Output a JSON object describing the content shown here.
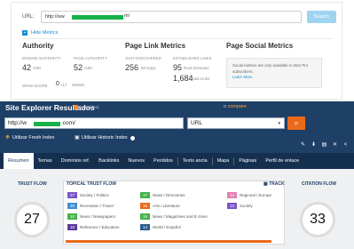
{
  "moz": {
    "url_label": "URL:",
    "url_prefix": "http://ww",
    "url_suffix": "m/",
    "search_label": "Search",
    "hide_metrics": "Hide Metrics",
    "authority": {
      "title": "Authority",
      "domain_authority_label": "DOMAIN AUTHORITY",
      "domain_authority_value": "42",
      "domain_authority_unit": "/100",
      "page_authority_label": "PAGE AUTHORITY",
      "page_authority_value": "52",
      "page_authority_unit": "/100",
      "spam_score_label": "SPAM SCORE",
      "spam_score_value": "0",
      "spam_score_unit": "/17"
    },
    "page_link_metrics": {
      "title": "Page Link Metrics",
      "just_discovered_label": "JUST-DISCOVERED",
      "just_discovered_value": "256",
      "just_discovered_unit": "60 Days",
      "established_links_label": "ESTABLISHED LINKS",
      "root_domains_value": "95",
      "root_domains_unit": "Root Domains",
      "total_links_value": "1,684",
      "total_links_unit": "Total Links"
    },
    "page_social_metrics": {
      "title": "Page Social Metrics",
      "message": "Social metrics are only available to Moz Pro subscribers.",
      "learn_more": "Learn More"
    }
  },
  "majestic": {
    "title": "Site Explorer Resultados",
    "video_label": "(ver vídeo)",
    "compare_prefix": "o",
    "compare_label": "compare",
    "url_prefix": "http://w",
    "url_suffix": ".com/",
    "scope_select": "URL",
    "fresh_index": "Utilizar Fresh Index",
    "historic_index": "Utilizar Historic Index",
    "tabs": [
      "Resumen",
      "Temas",
      "Dominios ref.",
      "Backlinks",
      "Nuevos",
      "Perdidos",
      "Texto ancla",
      "Mapa",
      "Páginas",
      "Perfil de enlace"
    ],
    "trust_flow_label": "TRUST FLOW",
    "trust_flow_value": "27",
    "citation_flow_label": "CITATION FLOW",
    "citation_flow_value": "33",
    "topical_title": "TOPICAL TRUST FLOW",
    "track_label": "TRACK",
    "topics": [
      {
        "score": "27",
        "name": "Society / Politics",
        "color": "#7b55c7"
      },
      {
        "score": "20",
        "name": "Recreation / Travel",
        "color": "#3f8fd2"
      },
      {
        "score": "10",
        "name": "News / Newspapers",
        "color": "#44b34a"
      },
      {
        "score": "18",
        "name": "Reference / Education",
        "color": "#5d3a9e"
      },
      {
        "score": "17",
        "name": "News / Directories",
        "color": "#44b34a"
      },
      {
        "score": "16",
        "name": "Arts / Literature",
        "color": "#ea6a1a"
      },
      {
        "score": "15",
        "name": "News / Magazines and E-zines",
        "color": "#44b34a"
      },
      {
        "score": "14",
        "name": "World / Español",
        "color": "#2e5e8e"
      },
      {
        "score": "14",
        "name": "Regional / Europe",
        "color": "#e47fb5"
      },
      {
        "score": "13",
        "name": "Society",
        "color": "#7b55c7"
      }
    ]
  }
}
